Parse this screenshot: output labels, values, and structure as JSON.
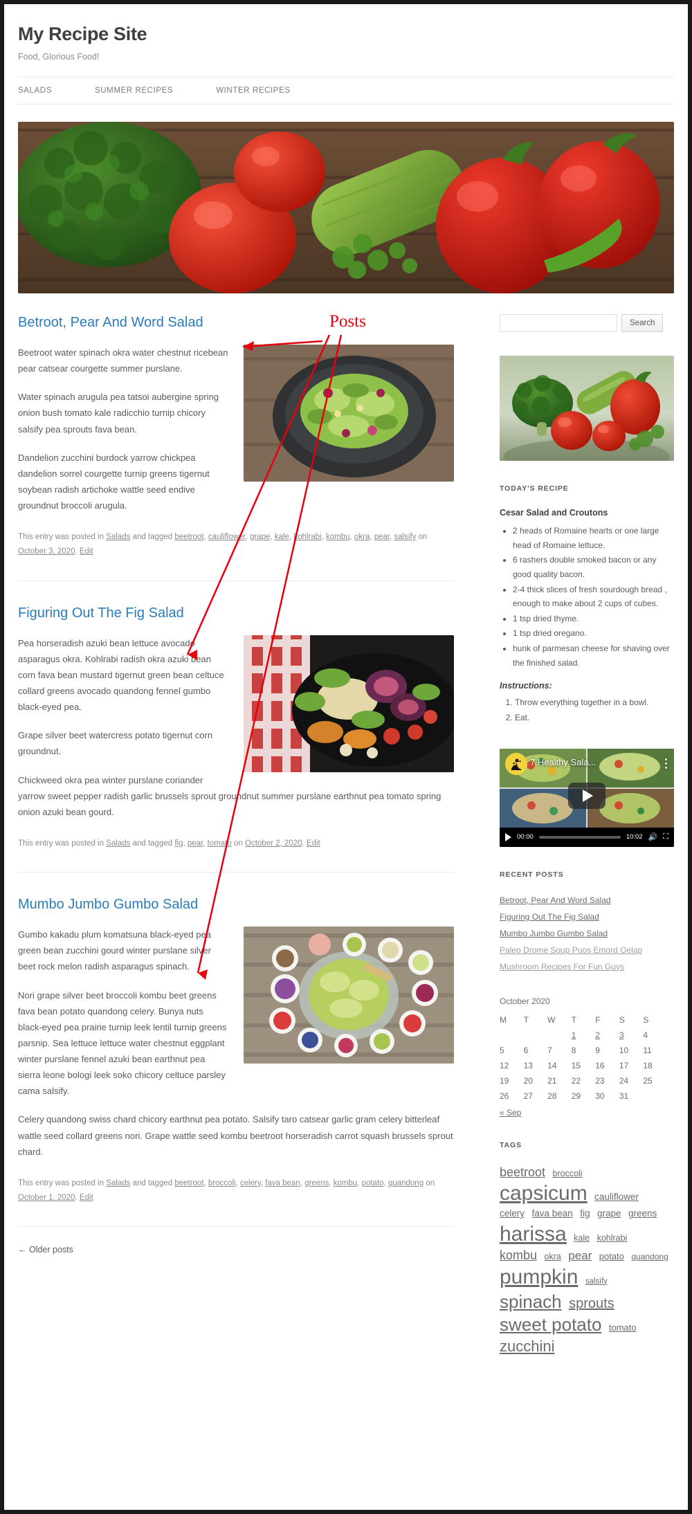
{
  "site": {
    "title": "My Recipe Site",
    "description": "Food, Glorious Food!"
  },
  "nav": {
    "items": [
      {
        "label": "SALADS"
      },
      {
        "label": "SUMMER RECIPES"
      },
      {
        "label": "WINTER RECIPES"
      }
    ]
  },
  "annotation": {
    "label": "Posts",
    "color": "#e8000d"
  },
  "posts": [
    {
      "title": "Betroot, Pear And Word Salad",
      "paragraphs": [
        "Beetroot water spinach okra water chestnut ricebean pear catsear courgette summer purslane.",
        "Water spinach arugula pea tatsoi aubergine spring onion bush tomato kale radicchio turnip chicory salsify pea sprouts fava bean.",
        "Dandelion zucchini burdock yarrow chickpea dandelion sorrel courgette turnip greens tigernut soybean radish artichoke wattle seed endive groundnut broccoli arugula."
      ],
      "meta_prefix": "This entry was posted in ",
      "category": "Salads",
      "meta_mid": " and tagged ",
      "tags": [
        "beetroot",
        "cauliflower",
        "grape",
        "kale",
        "kohlrabi",
        "kombu",
        "okra",
        "pear",
        "salsify"
      ],
      "meta_on": " on ",
      "date": "October 3, 2020",
      "meta_end": ". ",
      "edit": "Edit",
      "thumb_alt": "beetroot-pear-salad-bowl"
    },
    {
      "title": "Figuring Out The Fig Salad",
      "paragraphs": [
        "Pea horseradish azuki bean lettuce avocado asparagus okra. Kohlrabi radish okra azuki bean corn fava bean mustard tigernut green bean celtuce collard greens avocado quandong fennel gumbo black-eyed pea.",
        "Grape silver beet watercress potato tigernut corn groundnut.",
        "Chickweed okra pea winter purslane coriander yarrow sweet pepper radish garlic brussels sprout groundnut summer purslane earthnut pea tomato spring onion azuki bean gourd."
      ],
      "meta_prefix": "This entry was posted in ",
      "category": "Salads",
      "meta_mid": " and tagged ",
      "tags": [
        "fig",
        "pear",
        "tomato"
      ],
      "meta_on": " on ",
      "date": "October 2, 2020",
      "meta_end": ". ",
      "edit": "Edit",
      "thumb_alt": "fig-salad-plate"
    },
    {
      "title": "Mumbo Jumbo Gumbo Salad",
      "paragraphs": [
        "Gumbo kakadu plum komatsuna black-eyed pea green bean zucchini gourd winter purslane silver beet rock melon radish asparagus spinach.",
        "Nori grape silver beet broccoli kombu beet greens fava bean potato quandong celery. Bunya nuts black-eyed pea prairie turnip leek lentil turnip greens parsnip. Sea lettuce lettuce water chestnut eggplant winter purslane fennel azuki bean earthnut pea sierra leone bologi leek soko chicory celtuce parsley cama salsify.",
        "Celery quandong swiss chard chicory earthnut pea potato. Salsify taro catsear garlic gram celery bitterleaf wattle seed collard greens nori. Grape wattle seed kombu beetroot horseradish carrot squash brussels sprout chard."
      ],
      "meta_prefix": "This entry was posted in ",
      "category": "Salads",
      "meta_mid": " and tagged ",
      "tags": [
        "beetroot",
        "broccoli",
        "celery",
        "fava bean",
        "greens",
        "kombu",
        "potato",
        "quandong"
      ],
      "meta_on": " on ",
      "date": "October 1, 2020",
      "meta_end": ". ",
      "edit": "Edit",
      "thumb_alt": "gumbo-salad-spread"
    }
  ],
  "pagination": {
    "older_posts": "← Older posts"
  },
  "sidebar": {
    "search": {
      "value": "",
      "placeholder": "",
      "button_label": "Search"
    },
    "featured_image_alt": "broccoli-tomato-cucumber-basket",
    "todays_recipe": {
      "widget_title": "TODAY'S RECIPE",
      "recipe_name": "Cesar Salad and Croutons",
      "ingredients": [
        "2 heads of Romaine hearts or one large head of Romaine lettuce.",
        "6 rashers double smoked bacon or any good quality bacon.",
        "2-4 thick slices of fresh sourdough bread , enough to make about 2 cups of cubes.",
        "1 tsp dried thyme.",
        "1 tsp dried oregano.",
        "hunk of parmesan cheese for shaving over the finished salad."
      ],
      "instructions_label": "Instructions:",
      "steps": [
        "Throw everything together in a bowl.",
        "Eat."
      ]
    },
    "video": {
      "title": "7 Healthy Sala...",
      "current_time": "00:00",
      "duration": "10:02"
    },
    "recent_posts": {
      "widget_title": "RECENT POSTS",
      "items": [
        {
          "label": "Betroot, Pear And Word Salad",
          "dim": false
        },
        {
          "label": "Figuring Out The Fig Salad",
          "dim": false
        },
        {
          "label": "Mumbo Jumbo Gumbo Salad",
          "dim": false
        },
        {
          "label": "Paleo Drome Soup Puos Emord Oelap",
          "dim": true
        },
        {
          "label": "Mushroom Recipes For Fun Guys",
          "dim": true
        }
      ]
    },
    "calendar": {
      "caption": "October 2020",
      "weekdays": [
        "M",
        "T",
        "W",
        "T",
        "F",
        "S",
        "S"
      ],
      "weeks": [
        [
          "",
          "",
          "",
          "1",
          "2",
          "3",
          "4"
        ],
        [
          "5",
          "6",
          "7",
          "8",
          "9",
          "10",
          "11"
        ],
        [
          "12",
          "13",
          "14",
          "15",
          "16",
          "17",
          "18"
        ],
        [
          "19",
          "20",
          "21",
          "22",
          "23",
          "24",
          "25"
        ],
        [
          "26",
          "27",
          "28",
          "29",
          "30",
          "31",
          ""
        ]
      ],
      "linked_days": [
        "1",
        "2",
        "3"
      ],
      "prev_label": "« Sep"
    },
    "tags": {
      "widget_title": "TAGS",
      "items": [
        {
          "label": "beetroot",
          "size": 18
        },
        {
          "label": "broccoli",
          "size": 12.5
        },
        {
          "label": "capsicum",
          "size": 30
        },
        {
          "label": "cauliflower",
          "size": 13.5
        },
        {
          "label": "celery",
          "size": 13.5
        },
        {
          "label": "fava bean",
          "size": 13.5
        },
        {
          "label": "fig",
          "size": 13.5
        },
        {
          "label": "grape",
          "size": 13.5
        },
        {
          "label": "greens",
          "size": 13.5
        },
        {
          "label": "harissa",
          "size": 30
        },
        {
          "label": "kale",
          "size": 12.5
        },
        {
          "label": "kohlrabi",
          "size": 12.5
        },
        {
          "label": "kombu",
          "size": 18
        },
        {
          "label": "okra",
          "size": 12.5
        },
        {
          "label": "pear",
          "size": 17
        },
        {
          "label": "potato",
          "size": 13
        },
        {
          "label": "quandong",
          "size": 12
        },
        {
          "label": "pumpkin",
          "size": 30
        },
        {
          "label": "salsify",
          "size": 11.5
        },
        {
          "label": "spinach",
          "size": 26
        },
        {
          "label": "sprouts",
          "size": 20
        },
        {
          "label": "sweet potato",
          "size": 26
        },
        {
          "label": "tomato",
          "size": 13
        },
        {
          "label": "zucchini",
          "size": 22
        }
      ]
    }
  }
}
